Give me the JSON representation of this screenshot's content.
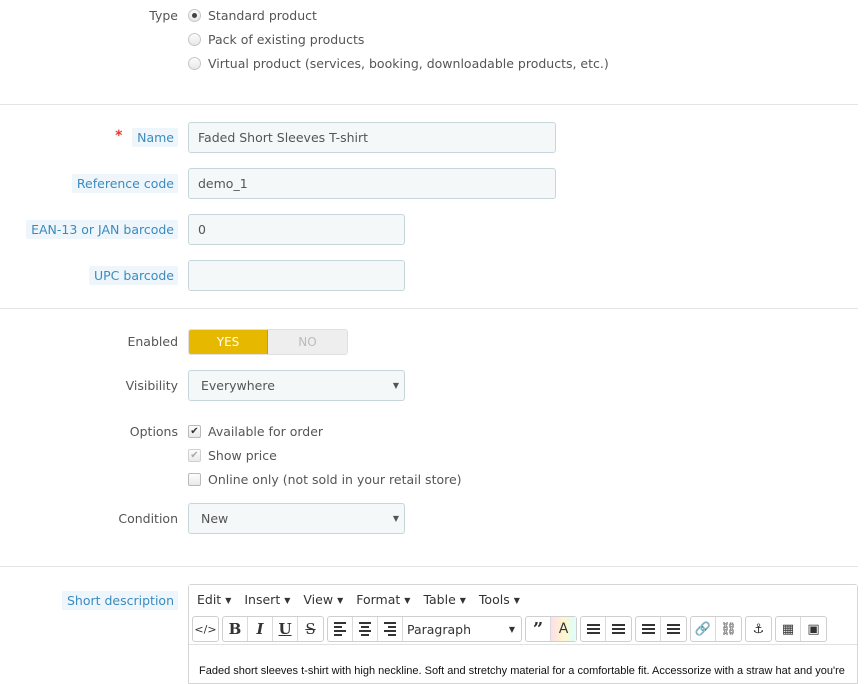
{
  "type_field": {
    "label": "Type",
    "options": [
      {
        "label": "Standard product",
        "selected": true
      },
      {
        "label": "Pack of existing products",
        "selected": false
      },
      {
        "label": "Virtual product (services, booking, downloadable products, etc.)",
        "selected": false
      }
    ]
  },
  "name_field": {
    "required_marker": "*",
    "label": "Name",
    "value": "Faded Short Sleeves T-shirt"
  },
  "reference_field": {
    "label": "Reference code",
    "value": "demo_1"
  },
  "ean_field": {
    "label": "EAN-13 or JAN barcode",
    "value": "0"
  },
  "upc_field": {
    "label": "UPC barcode",
    "value": ""
  },
  "enabled_field": {
    "label": "Enabled",
    "yes": "YES",
    "no": "NO",
    "value": "YES",
    "accent": "#e6b800"
  },
  "visibility_field": {
    "label": "Visibility",
    "value": "Everywhere"
  },
  "options_field": {
    "label": "Options",
    "items": [
      {
        "label": "Available for order",
        "checked": true
      },
      {
        "label": "Show price",
        "checked": true,
        "disabled": true
      },
      {
        "label": "Online only (not sold in your retail store)",
        "checked": false
      }
    ]
  },
  "condition_field": {
    "label": "Condition",
    "value": "New"
  },
  "short_description": {
    "label": "Short description",
    "menu": [
      "Edit",
      "Insert",
      "View",
      "Format",
      "Table",
      "Tools"
    ],
    "block_format": "Paragraph",
    "content": "Faded short sleeves t-shirt with high neckline. Soft and stretchy material for a comfortable fit. Accessorize with a straw hat and you're"
  },
  "icons": {
    "code": "</>",
    "bold": "B",
    "italic": "I",
    "underline": "U",
    "strike": "S",
    "blockquote": "”",
    "text_color": "A",
    "check": "✔",
    "caret": "▼"
  }
}
